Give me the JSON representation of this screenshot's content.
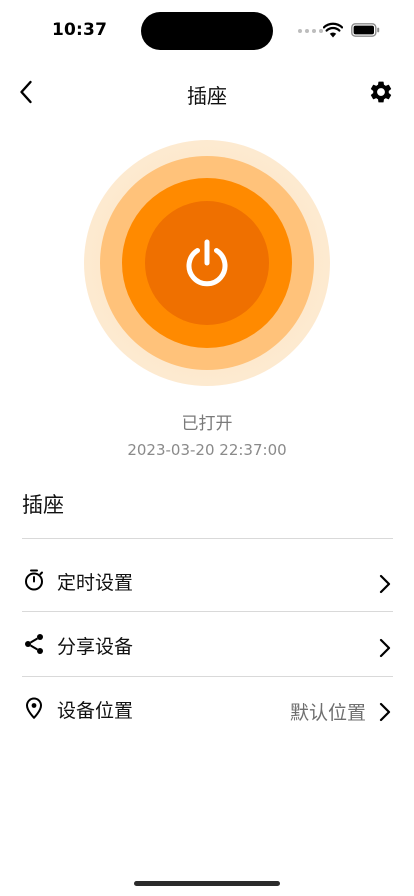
{
  "status_bar": {
    "time": "10:37"
  },
  "nav": {
    "title": "插座"
  },
  "power": {
    "state_text": "已打开",
    "timestamp": "2023-03-20 22:37:00"
  },
  "device": {
    "name": "插座"
  },
  "menu": [
    {
      "icon": "timer-icon",
      "label": "定时设置",
      "value": ""
    },
    {
      "icon": "share-icon",
      "label": "分享设备",
      "value": ""
    },
    {
      "icon": "location-pin-icon",
      "label": "设备位置",
      "value": "默认位置"
    }
  ],
  "colors": {
    "accent": "#ff8a00",
    "accent_dark": "#ef7000",
    "ring_light": "#ffc27a",
    "ring_halo": "#fde2bd"
  }
}
